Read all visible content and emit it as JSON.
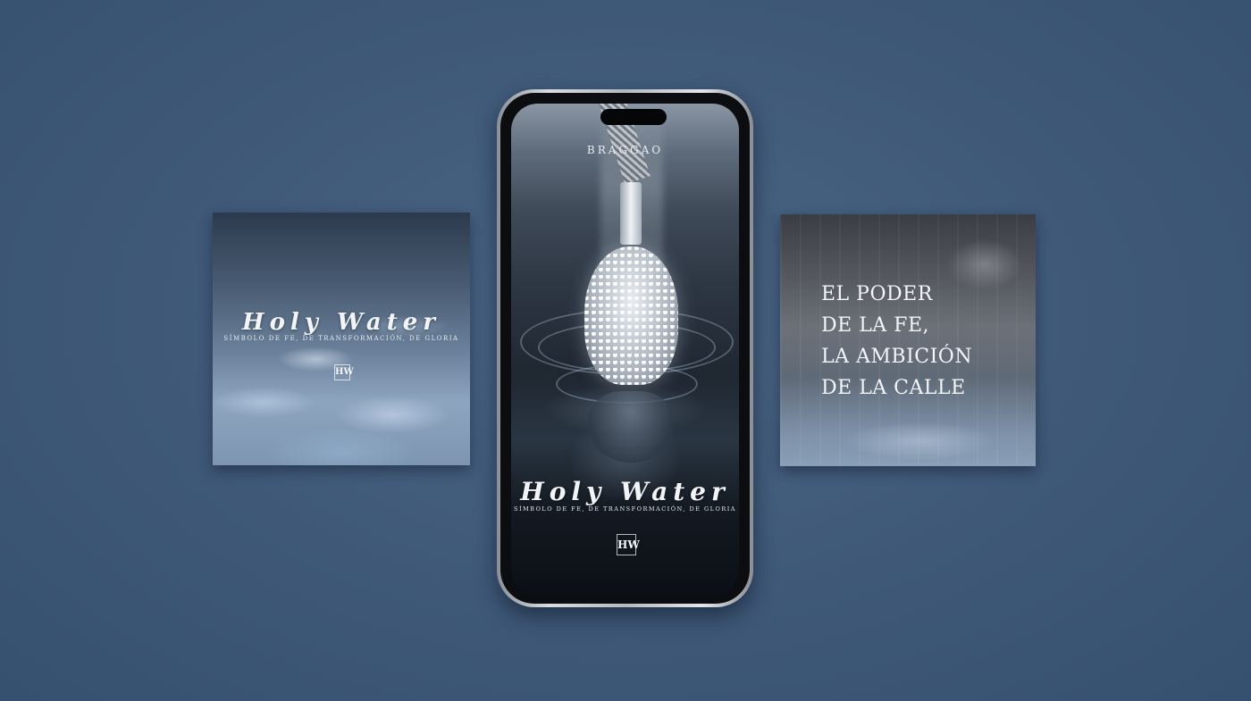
{
  "left_card": {
    "title": "Holy Water",
    "tagline": "Símbolo de fe, de transformación, de gloria",
    "logo": "HW"
  },
  "phone": {
    "brand": "BRAGGAO",
    "title": "Holy Water",
    "tagline": "Símbolo de fe, de transformación, de gloria",
    "logo": "HW"
  },
  "right_card": {
    "lines": [
      "EL PODER",
      "DE LA FE,",
      "LA AMBICIÓN",
      "DE LA CALLE"
    ]
  },
  "colors": {
    "background": "#3f5878",
    "text": "#f2f4f7"
  }
}
